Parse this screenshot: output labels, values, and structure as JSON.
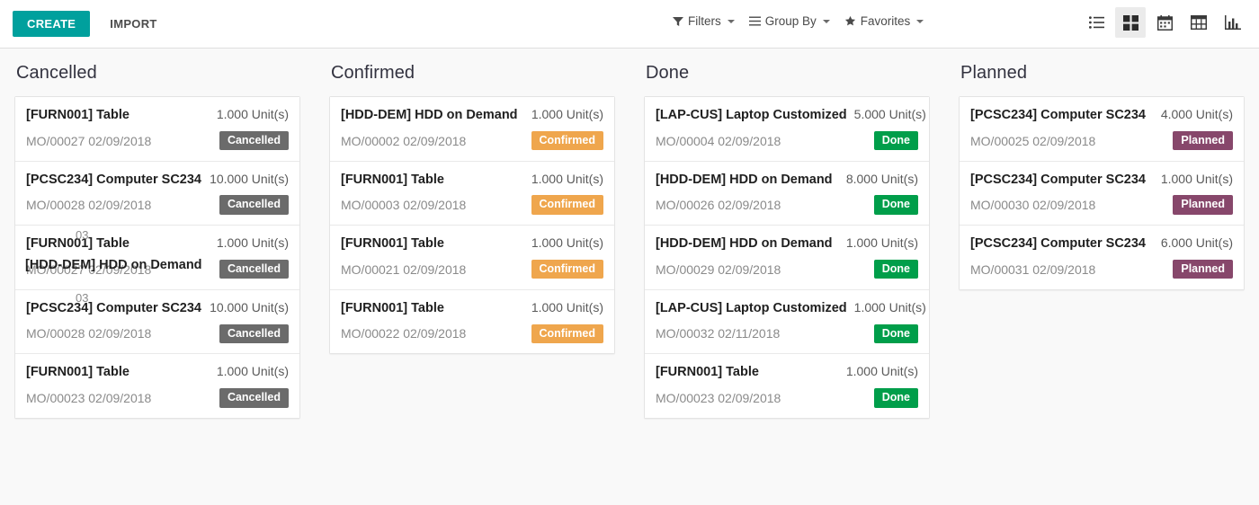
{
  "toolbar": {
    "create_label": "CREATE",
    "import_label": "IMPORT",
    "filters_label": "Filters",
    "group_by_label": "Group By",
    "favorites_label": "Favorites",
    "views": [
      {
        "name": "list-view",
        "icon": "list-icon",
        "active": false
      },
      {
        "name": "kanban-view",
        "icon": "kanban-icon",
        "active": true
      },
      {
        "name": "calendar-view",
        "icon": "calendar-icon",
        "active": false
      },
      {
        "name": "pivot-view",
        "icon": "pivot-table-icon",
        "active": false
      },
      {
        "name": "graph-view",
        "icon": "bar-chart-icon",
        "active": false
      }
    ]
  },
  "colors": {
    "primary": "#00a09d",
    "cancelled": "#6b6b6b",
    "confirmed": "#efa64d",
    "done": "#009e4a",
    "planned": "#87476b",
    "page_background": "#f9f9f9",
    "card_background": "#ffffff"
  },
  "columns": [
    {
      "title": "Cancelled",
      "badge_class": "cancelled",
      "cards": [
        {
          "product": "[FURN001] Table",
          "qty": "1.000 Unit(s)",
          "reference": "MO/00027 02/09/2018",
          "state": "Cancelled"
        },
        {
          "product": "[PCSC234] Computer SC234",
          "qty": "10.000 Unit(s)",
          "reference": "MO/00028 02/09/2018",
          "state": "Cancelled"
        },
        {
          "product": "[FURN001] Table",
          "qty": "1.000 Unit(s)",
          "reference": "MO/00027 02/09/2018",
          "state": "Cancelled"
        },
        {
          "product": "[PCSC234] Computer SC234",
          "qty": "10.000 Unit(s)",
          "reference": "MO/00028 02/09/2018",
          "state": "Cancelled"
        },
        {
          "product": "[FURN001] Table",
          "qty": "1.000 Unit(s)",
          "reference": "MO/00023 02/09/2018",
          "state": "Cancelled"
        }
      ],
      "drag_ghost": {
        "product": "[HDD-DEM] HDD on Demand"
      },
      "text_fragments": [
        "03",
        "03"
      ]
    },
    {
      "title": "Confirmed",
      "badge_class": "confirmed",
      "cards": [
        {
          "product": "[HDD-DEM] HDD on Demand",
          "qty": "1.000 Unit(s)",
          "reference": "MO/00002 02/09/2018",
          "state": "Confirmed"
        },
        {
          "product": "[FURN001] Table",
          "qty": "1.000 Unit(s)",
          "reference": "MO/00003 02/09/2018",
          "state": "Confirmed"
        },
        {
          "product": "[FURN001] Table",
          "qty": "1.000 Unit(s)",
          "reference": "MO/00021 02/09/2018",
          "state": "Confirmed"
        },
        {
          "product": "[FURN001] Table",
          "qty": "1.000 Unit(s)",
          "reference": "MO/00022 02/09/2018",
          "state": "Confirmed"
        }
      ]
    },
    {
      "title": "Done",
      "badge_class": "done",
      "cards": [
        {
          "product": "[LAP-CUS] Laptop Customized",
          "qty": "5.000 Unit(s)",
          "reference": "MO/00004 02/09/2018",
          "state": "Done"
        },
        {
          "product": "[HDD-DEM] HDD on Demand",
          "qty": "8.000 Unit(s)",
          "reference": "MO/00026 02/09/2018",
          "state": "Done"
        },
        {
          "product": "[HDD-DEM] HDD on Demand",
          "qty": "1.000 Unit(s)",
          "reference": "MO/00029 02/09/2018",
          "state": "Done"
        },
        {
          "product": "[LAP-CUS] Laptop Customized",
          "qty": "1.000 Unit(s)",
          "reference": "MO/00032 02/11/2018",
          "state": "Done"
        },
        {
          "product": "[FURN001] Table",
          "qty": "1.000 Unit(s)",
          "reference": "MO/00023 02/09/2018",
          "state": "Done"
        }
      ]
    },
    {
      "title": "Planned",
      "badge_class": "planned",
      "cards": [
        {
          "product": "[PCSC234] Computer SC234",
          "qty": "4.000 Unit(s)",
          "reference": "MO/00025 02/09/2018",
          "state": "Planned"
        },
        {
          "product": "[PCSC234] Computer SC234",
          "qty": "1.000 Unit(s)",
          "reference": "MO/00030 02/09/2018",
          "state": "Planned"
        },
        {
          "product": "[PCSC234] Computer SC234",
          "qty": "6.000 Unit(s)",
          "reference": "MO/00031 02/09/2018",
          "state": "Planned"
        }
      ]
    }
  ]
}
